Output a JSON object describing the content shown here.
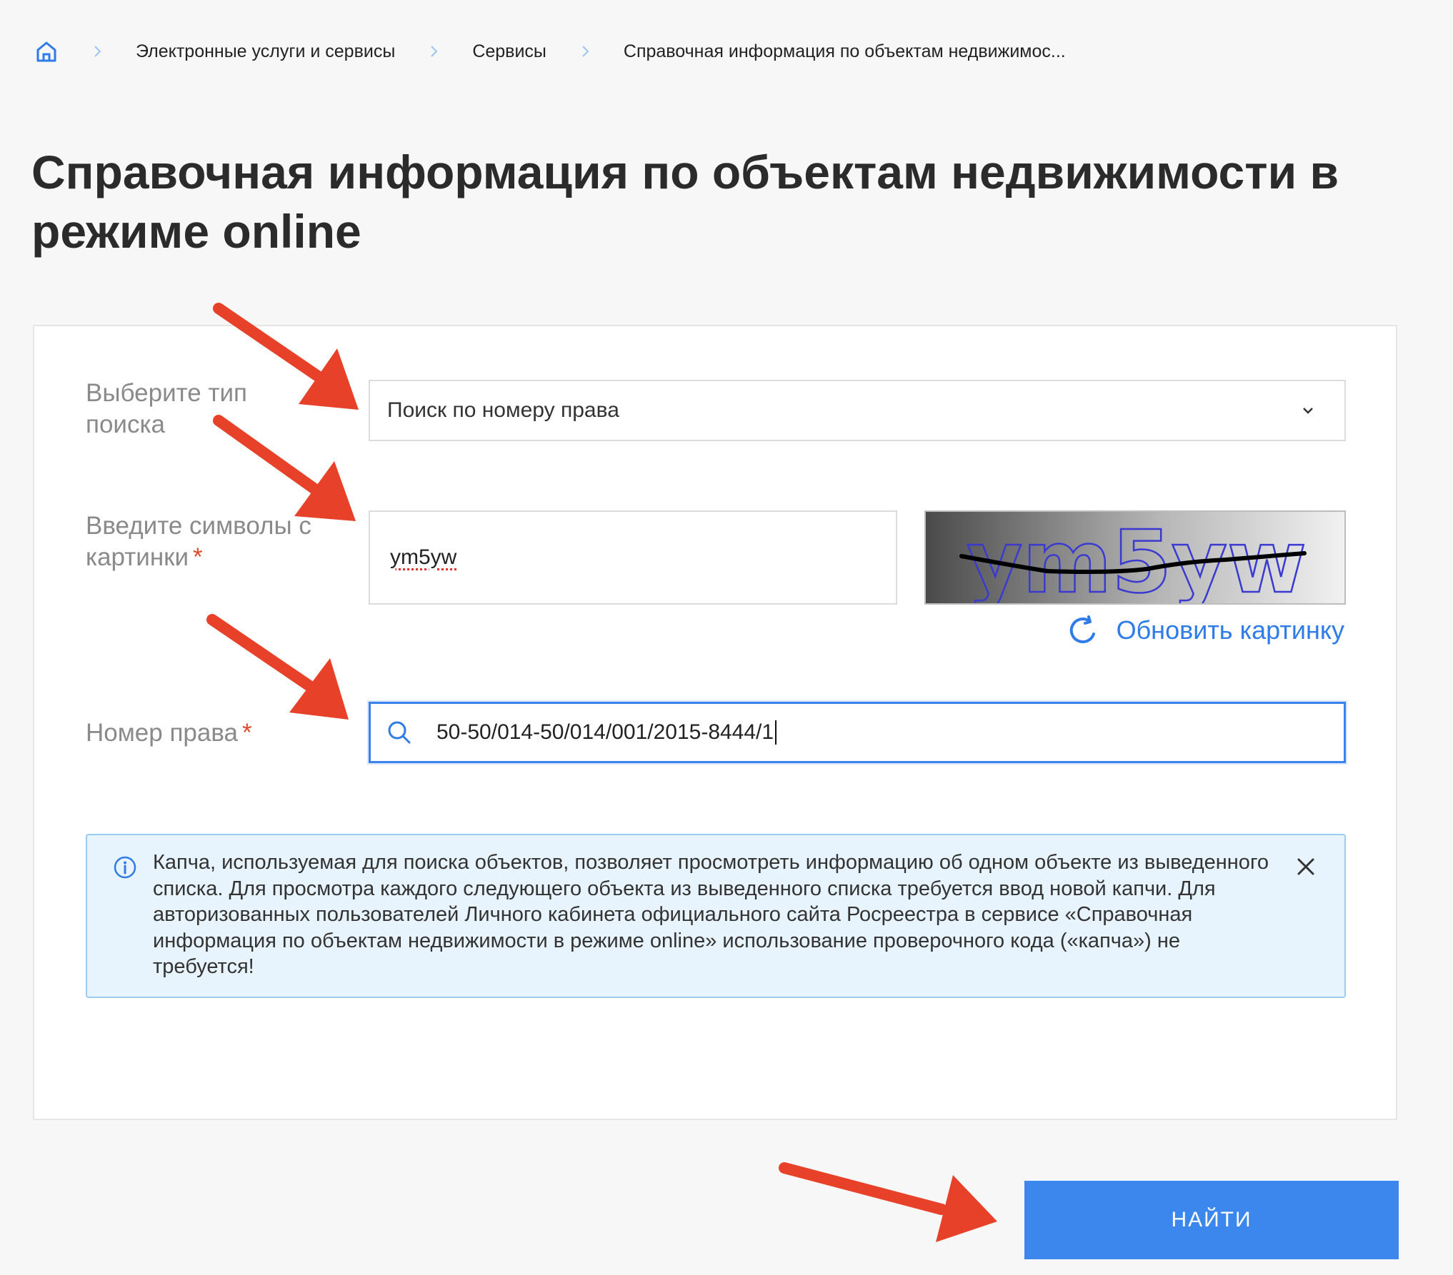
{
  "breadcrumb": {
    "items": [
      "Электронные услуги и сервисы",
      "Сервисы",
      "Справочная информация по объектам недвижимос..."
    ]
  },
  "page_title": "Справочная информация по объектам недвижимости в режиме online",
  "form": {
    "search_type_label": "Выберите тип поиска",
    "search_type_value": "Поиск по номеру права",
    "captcha_label": "Введите символы с картинки",
    "captcha_value": "ym5yw",
    "captcha_image_text": "ym5yw",
    "refresh_label": "Обновить картинку",
    "number_label": "Номер права",
    "required_mark": "*",
    "number_value": "50-50/014-50/014/001/2015-8444/1"
  },
  "info": {
    "text": "Капча, используемая для поиска объектов, позволяет просмотреть информацию об одном объекте из выведенного списка. Для просмотра каждого следующего объекта из выведенного списка требуется ввод новой капчи. Для авторизованных пользователей Личного кабинета официального сайта Росреестра в сервисе «Справочная информация по объектам недвижимости в режиме online» использование проверочного кода («капча») не требуется!"
  },
  "find_button_label": "НАЙТИ",
  "colors": {
    "accent": "#3b87ee",
    "link": "#2f7ce8",
    "arrow": "#e8412a",
    "info_bg": "#e8f4fd",
    "required": "#e04a2f"
  },
  "icons": [
    "home-icon",
    "chevron-right-icon",
    "chevron-down-icon",
    "refresh-icon",
    "search-icon",
    "info-icon",
    "close-icon",
    "arrow-annotation"
  ]
}
